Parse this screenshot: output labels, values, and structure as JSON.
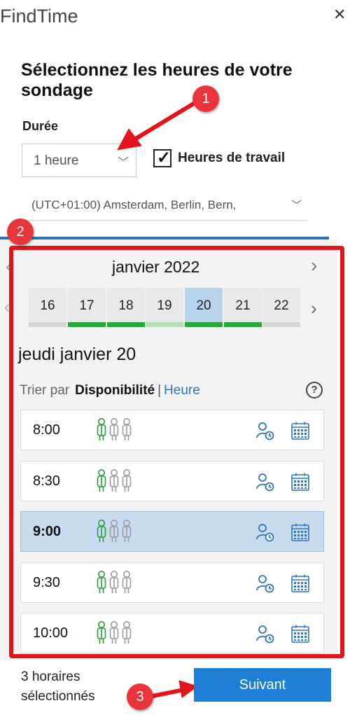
{
  "app": {
    "title": "FindTime",
    "close_glyph": "✕"
  },
  "form": {
    "heading": "Sélectionnez les heures de votre sondage",
    "duration_label": "Durée",
    "duration_value": "1 heure",
    "working_hours_label": "Heures de travail",
    "working_hours_checked": true,
    "timezone_value": "(UTC+01:00) Amsterdam, Berlin, Bern,"
  },
  "calendar": {
    "month_label": "janvier 2022",
    "days": [
      {
        "num": "16",
        "availability": "none"
      },
      {
        "num": "17",
        "availability": "available"
      },
      {
        "num": "18",
        "availability": "available"
      },
      {
        "num": "19",
        "availability": "partial"
      },
      {
        "num": "20",
        "availability": "available",
        "selected": true
      },
      {
        "num": "21",
        "availability": "available"
      },
      {
        "num": "22",
        "availability": "none"
      }
    ],
    "colors": {
      "available": "#2aa53a",
      "partial": "#b6dcb8",
      "none": "#d4d4d4"
    },
    "selected_day_heading": "jeudi janvier 20",
    "sort_label": "Trier par",
    "sort_active": "Disponibilité",
    "sort_separator": "|",
    "sort_other": "Heure",
    "help_glyph": "?"
  },
  "slots": [
    {
      "time": "8:00",
      "selected": false,
      "available_attendees": 1,
      "total_attendees": 3
    },
    {
      "time": "8:30",
      "selected": false,
      "available_attendees": 1,
      "total_attendees": 3
    },
    {
      "time": "9:00",
      "selected": true,
      "available_attendees": 1,
      "total_attendees": 3
    },
    {
      "time": "9:30",
      "selected": false,
      "available_attendees": 1,
      "total_attendees": 3
    },
    {
      "time": "10:00",
      "selected": false,
      "available_attendees": 1,
      "total_attendees": 3
    }
  ],
  "slot_icons": {
    "schedule": "person-clock-icon",
    "calendar": "calendar-icon"
  },
  "footer": {
    "selected_count": "3 horaires sélectionnés",
    "next_label": "Suivant"
  },
  "annotations": {
    "badges": [
      "1",
      "2",
      "3"
    ],
    "color": "#e3141b"
  }
}
